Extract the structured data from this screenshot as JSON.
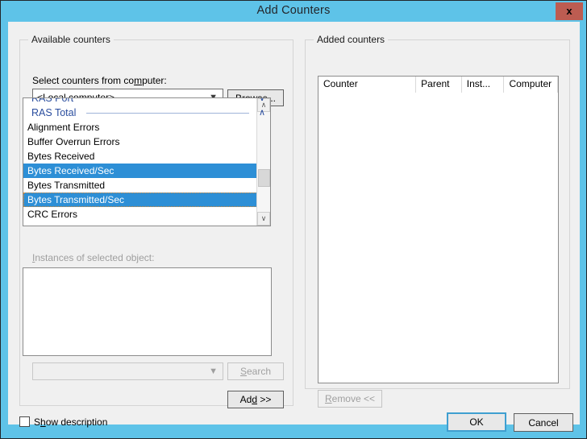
{
  "window": {
    "title": "Add Counters",
    "close_label": "x",
    "titlebar_color": "#5ec3e8",
    "close_color": "#bd5c51"
  },
  "available": {
    "group_label": "Available counters",
    "select_label": "Select counters from computer:",
    "computer_combo": {
      "value": "<Local computer>",
      "arrow": "chevron-down-icon"
    },
    "browse_button": "Browse...",
    "counters": [
      {
        "text": "RAS Port",
        "type": "group",
        "chevron": "∨",
        "clipped": true
      },
      {
        "text": "RAS Total",
        "type": "group",
        "chevron": "∧",
        "clipped": false
      },
      {
        "text": "Alignment Errors",
        "type": "item",
        "selected": false
      },
      {
        "text": "Buffer Overrun Errors",
        "type": "item",
        "selected": false
      },
      {
        "text": "Bytes Received",
        "type": "item",
        "selected": false
      },
      {
        "text": "Bytes Received/Sec",
        "type": "item",
        "selected": true
      },
      {
        "text": "Bytes Transmitted",
        "type": "item",
        "selected": false
      },
      {
        "text": "Bytes Transmitted/Sec",
        "type": "item",
        "selected": true,
        "focused": true
      },
      {
        "text": "CRC Errors",
        "type": "item",
        "selected": false
      }
    ],
    "scrollbar": {
      "up": "∧",
      "down": "∨"
    },
    "instances_label": "Instances of selected object:",
    "instances_items": [],
    "instance_combo": {
      "value": "",
      "arrow": "chevron-down-icon"
    },
    "search_button": "Search",
    "add_button": "Add >>",
    "selection_color": "#2d8fd6",
    "group_text_color": "#2a4d9e"
  },
  "added": {
    "group_label": "Added counters",
    "columns": [
      "Counter",
      "Parent",
      "Inst...",
      "Computer"
    ],
    "rows": [],
    "remove_button": "Remove <<"
  },
  "footer": {
    "show_description": "Show description",
    "show_description_checked": false,
    "ok_button": "OK",
    "cancel_button": "Cancel"
  }
}
